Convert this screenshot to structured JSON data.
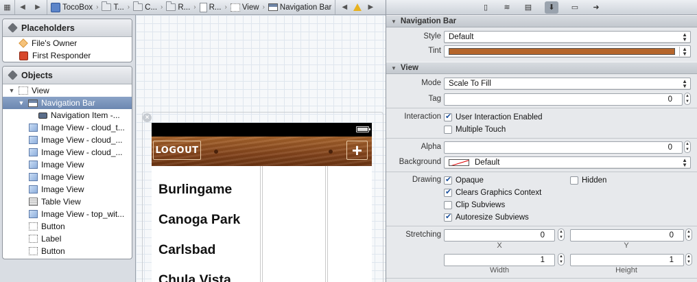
{
  "jumpbar": {
    "crumbs": [
      "TocoBox",
      "T...",
      "C...",
      "R...",
      "R...",
      "View",
      "Navigation Bar"
    ]
  },
  "placeholders": {
    "title": "Placeholders",
    "items": [
      "File's Owner",
      "First Responder"
    ]
  },
  "objects": {
    "title": "Objects",
    "items": [
      {
        "label": "View",
        "icon": "view-icon"
      },
      {
        "label": "Navigation Bar",
        "icon": "navigation-bar-icon"
      },
      {
        "label": "Navigation Item -...",
        "icon": "navigation-item-icon"
      },
      {
        "label": "Image View - cloud_t...",
        "icon": "image-view-icon"
      },
      {
        "label": "Image View - cloud_...",
        "icon": "image-view-icon"
      },
      {
        "label": "Image View - cloud_...",
        "icon": "image-view-icon"
      },
      {
        "label": "Image View",
        "icon": "image-view-icon"
      },
      {
        "label": "Image View",
        "icon": "image-view-icon"
      },
      {
        "label": "Image View",
        "icon": "image-view-icon"
      },
      {
        "label": "Table View",
        "icon": "table-view-icon"
      },
      {
        "label": "Image View - top_wit...",
        "icon": "image-view-icon"
      },
      {
        "label": "Button",
        "icon": "button-icon"
      },
      {
        "label": "Label",
        "icon": "label-icon"
      },
      {
        "label": "Button",
        "icon": "button-icon"
      }
    ]
  },
  "device": {
    "logout_label": "LOGOUT",
    "add_label": "+",
    "cities": [
      "Burlingame",
      "Canoga Park",
      "Carlsbad",
      "Chula Vista"
    ]
  },
  "inspector": {
    "navigation_bar": {
      "title": "Navigation Bar",
      "style_label": "Style",
      "style_value": "Default",
      "tint_label": "Tint",
      "tint_color": "#b5652a"
    },
    "view": {
      "title": "View",
      "mode_label": "Mode",
      "mode_value": "Scale To Fill",
      "tag_label": "Tag",
      "tag_value": "0",
      "interaction_label": "Interaction",
      "user_interaction": "User Interaction Enabled",
      "multiple_touch": "Multiple Touch",
      "alpha_label": "Alpha",
      "alpha_value": "0",
      "background_label": "Background",
      "background_value": "Default",
      "drawing_label": "Drawing",
      "opaque": "Opaque",
      "hidden": "Hidden",
      "clears_graphics": "Clears Graphics Context",
      "clip_subviews": "Clip Subviews",
      "autoresize_subviews": "Autoresize Subviews",
      "stretching_label": "Stretching",
      "stretch_x": "0",
      "stretch_y": "0",
      "stretch_width": "1",
      "stretch_height": "1",
      "x_caption": "X",
      "y_caption": "Y",
      "width_caption": "Width",
      "height_caption": "Height"
    }
  }
}
